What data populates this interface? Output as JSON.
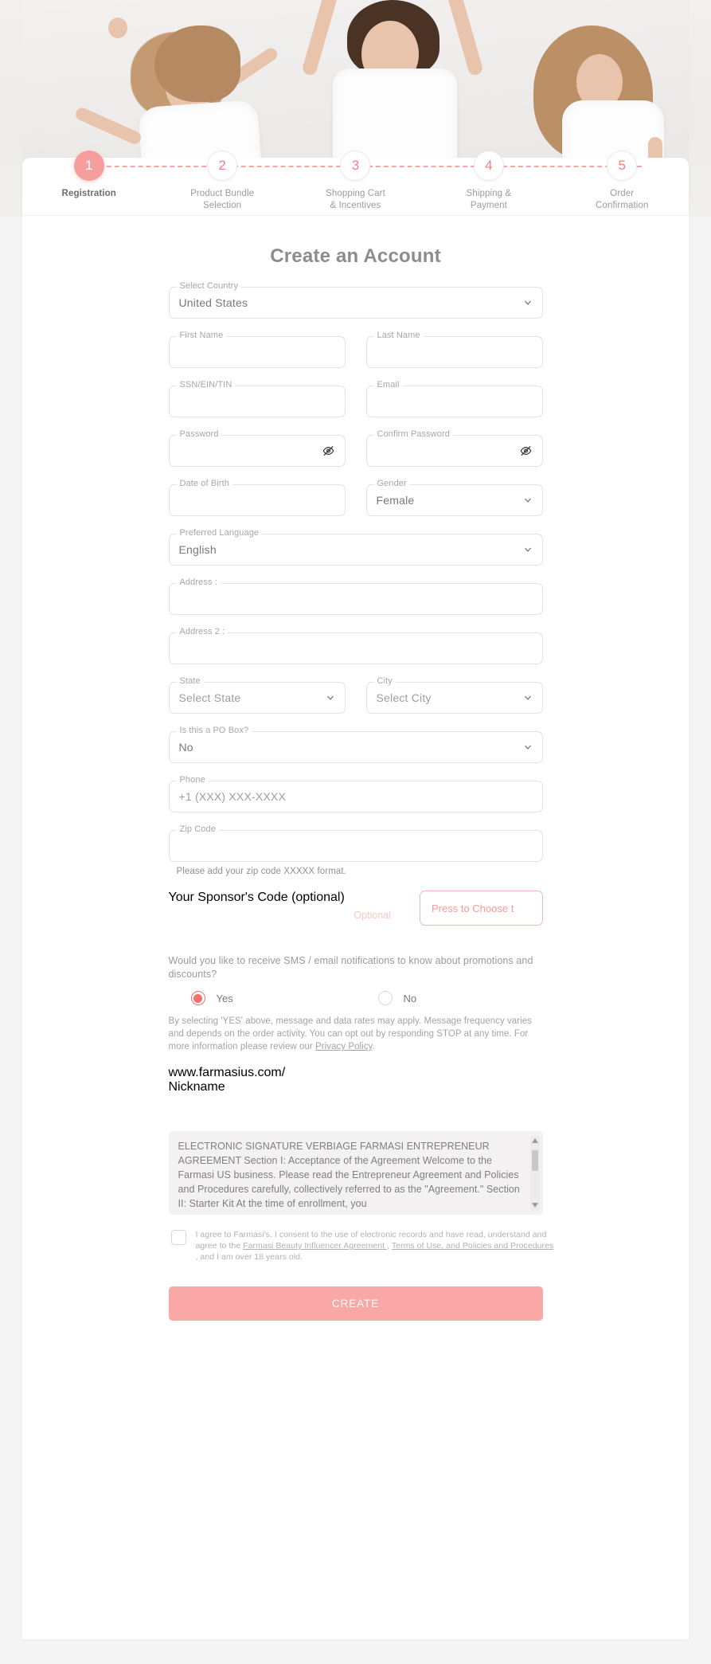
{
  "hero": {
    "alt": "three women in white t-shirts dancing"
  },
  "stepper": {
    "steps": [
      {
        "number": "1",
        "label": "Registration",
        "active": true
      },
      {
        "number": "2",
        "label": "Product Bundle\nSelection",
        "active": false
      },
      {
        "number": "3",
        "label": "Shopping Cart\n& Incentives",
        "active": false
      },
      {
        "number": "4",
        "label": "Shipping &\nPayment",
        "active": false
      },
      {
        "number": "5",
        "label": "Order\nConfirmation",
        "active": false
      }
    ]
  },
  "form": {
    "title": "Create an Account",
    "country": {
      "label": "Select Country",
      "value": "United States"
    },
    "first_name": {
      "label": "First Name",
      "value": ""
    },
    "last_name": {
      "label": "Last Name",
      "value": ""
    },
    "ssn": {
      "label": "SSN/EIN/TIN",
      "value": ""
    },
    "email": {
      "label": "Email",
      "value": ""
    },
    "password": {
      "label": "Password",
      "value": ""
    },
    "confirm_password": {
      "label": "Confirm Password",
      "value": ""
    },
    "dob": {
      "label": "Date of Birth",
      "value": ""
    },
    "gender": {
      "label": "Gender",
      "value": "Female"
    },
    "language": {
      "label": "Preferred Language",
      "value": "English"
    },
    "address": {
      "label": "Address :",
      "value": ""
    },
    "address2": {
      "label": "Address 2 :",
      "value": ""
    },
    "state": {
      "label": "State",
      "value": "Select State"
    },
    "city": {
      "label": "City",
      "value": "Select City"
    },
    "po_box": {
      "label": "Is this a PO Box?",
      "value": "No"
    },
    "phone": {
      "label": "Phone",
      "value": "+1 (XXX) XXX-XXXX"
    },
    "zip": {
      "label": "Zip Code",
      "value": "",
      "helper": "Please add your zip code XXXXX format."
    },
    "sponsor": {
      "label": "Your Sponsor's Code (optional)",
      "value": "",
      "optional_tag": "Optional",
      "button": "Press to Choose t"
    },
    "sms": {
      "question": "Would you like to receive SMS / email notifications to know about promotions and discounts?",
      "yes": "Yes",
      "no": "No",
      "selected": "yes",
      "legal_part1": "By selecting 'YES' above, message and data rates may apply. Message frequency varies and depends on the order activity. You can opt out by responding STOP at any time. For more information please review our ",
      "legal_link": "Privacy Policy",
      "legal_part2": "."
    },
    "nickname": {
      "label": "www.farmasius.com/",
      "placeholder": "Nickname",
      "value": "Nickname"
    },
    "terms_text": "ELECTRONIC SIGNATURE VERBIAGE FARMASI ENTREPRENEUR AGREEMENT Section I: Acceptance of the Agreement Welcome to the Farmasi US business. Please read the Entrepreneur Agreement and Policies and Procedures carefully, collectively referred to as the \"Agreement.\" Section II: Starter Kit At the time of enrollment, you",
    "agreement": {
      "part1": "I agree to Farmasi's. I consent to the use of electronic records and have read, understand and agree to the ",
      "link1": "Farmasi Beauty Influencer Agreement ",
      "mid": ", ",
      "link2": "Terms of Use, and Policies and Procedures ",
      "part2": ", and I am over 18 years old."
    },
    "create_button": "CREATE"
  },
  "colors": {
    "accent": "#f79d9d",
    "accent_strong": "#f4706c",
    "button": "#f9a7a7",
    "text_muted": "#9b9b9b"
  }
}
